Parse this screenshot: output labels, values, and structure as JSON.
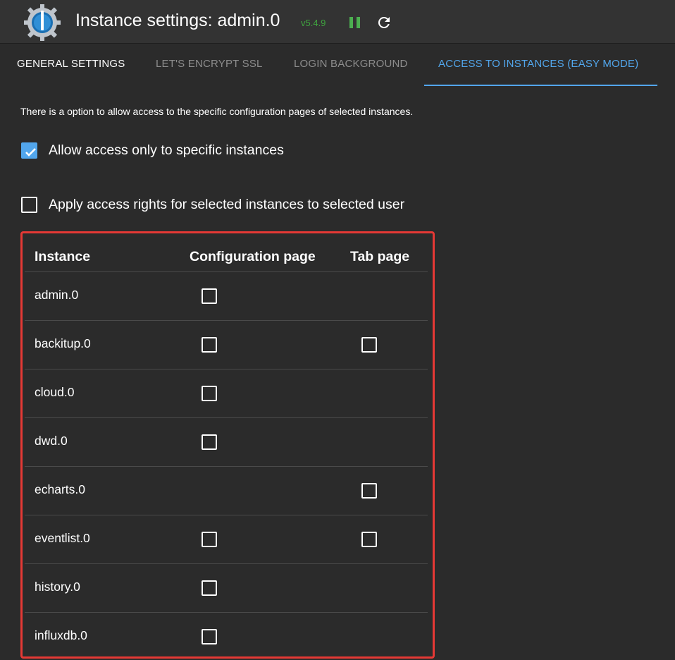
{
  "header": {
    "title": "Instance settings: admin.0",
    "version": "v5.4.9",
    "accent_color": "#52a6ec"
  },
  "tabs": [
    {
      "label": "General Settings"
    },
    {
      "label": "Let's Encrypt SSL"
    },
    {
      "label": "Login Background"
    },
    {
      "label": "Access to instances (easy mode)"
    }
  ],
  "content": {
    "intro": "There is a option to allow access to the specific configuration pages of selected instances.",
    "allow_specific": {
      "label": "Allow access only to specific instances",
      "checked": true
    },
    "apply_rights": {
      "label": "Apply access rights for selected instances to selected user",
      "checked": false
    }
  },
  "table": {
    "columns": [
      "Instance",
      "Configuration page",
      "Tab page"
    ],
    "rows": [
      {
        "name": "admin.0",
        "config": true,
        "tab": false
      },
      {
        "name": "backitup.0",
        "config": true,
        "tab": true
      },
      {
        "name": "cloud.0",
        "config": true,
        "tab": false
      },
      {
        "name": "dwd.0",
        "config": true,
        "tab": false
      },
      {
        "name": "echarts.0",
        "config": false,
        "tab": true
      },
      {
        "name": "eventlist.0",
        "config": true,
        "tab": true
      },
      {
        "name": "history.0",
        "config": true,
        "tab": false
      },
      {
        "name": "influxdb.0",
        "config": true,
        "tab": false
      }
    ],
    "highlight_color": "#e53935"
  }
}
